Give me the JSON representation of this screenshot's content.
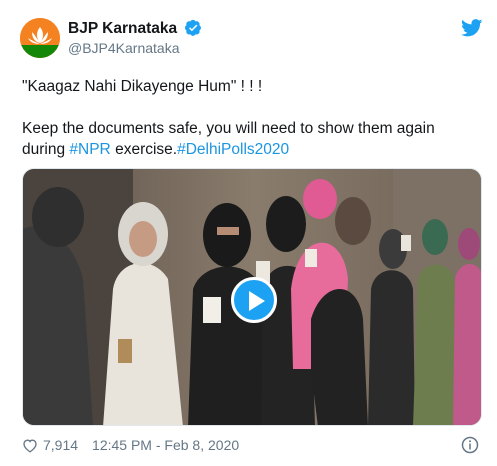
{
  "account": {
    "name": "BJP Karnataka",
    "handle": "@BJP4Karnataka",
    "verified": true
  },
  "tweet": {
    "line1": "\"Kaagaz Nahi Dikayenge Hum\" ! ! !",
    "line2_before": "Keep the documents safe, you will need to show them again during ",
    "hashtag1": "#NPR",
    "line2_middle": " exercise.",
    "hashtag2": "#DelhiPolls2020"
  },
  "footer": {
    "likes": "7,914",
    "timestamp": "12:45 PM - Feb 8, 2020"
  },
  "icons": {
    "twitter": "twitter-bird-icon",
    "like": "heart-icon",
    "info": "info-icon",
    "play": "play-icon",
    "verified": "verified-badge-icon"
  },
  "colors": {
    "brand_blue": "#1da1f2",
    "link_blue": "#1b95e0",
    "muted_gray": "#657786",
    "avatar_orange": "#f58220"
  }
}
